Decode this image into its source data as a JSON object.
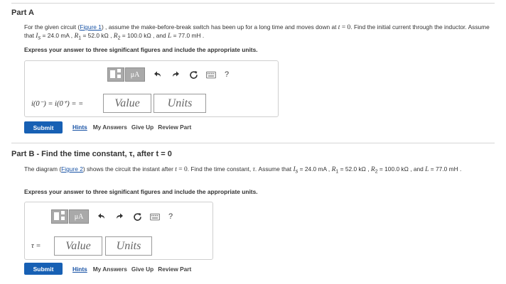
{
  "part_a": {
    "title": "Part A",
    "text_1": "For the given circuit (",
    "figure_link": "Figure 1",
    "text_2": ") , assume the make-before-break switch has been up for a long time and moves down at ",
    "math_t": "t",
    "math_eq0": " = 0",
    "text_3": ". Find the initial current through the inductor. Assume that ",
    "is_sym": "I",
    "is_sub": "s",
    "is_val": " = 24.0 mA",
    "r1_sym": "R",
    "r1_sub": "1",
    "r1_val": " = 52.0 kΩ",
    "r2_sym": "R",
    "r2_sub": "2",
    "r2_val": " = 100.0 kΩ",
    "l_sym": "L",
    "l_val": " = 77.0 mH",
    "sep": " , ",
    "and": " , and ",
    "end": " .",
    "instruction": "Express your answer to three significant figures and include the appropriate units.",
    "toolbar": {
      "mu_label": "μA",
      "help_label": "?"
    },
    "answer_lhs": "i(0⁻) = i(0⁺) = =",
    "value_placeholder": "Value",
    "units_placeholder": "Units",
    "submit_label": "Submit",
    "links": {
      "hints": "Hints",
      "my_answers": "My Answers",
      "give_up": "Give Up",
      "review_part": "Review Part"
    }
  },
  "part_b": {
    "title": "Part B - Find the time constant, τ, after t = 0",
    "text_1": "The diagram (",
    "figure_link": "Figure 2",
    "text_2": ") shows the circuit the instant after ",
    "math_t": "t",
    "math_eq0": " = 0",
    "text_3": ". Find the time constant, ",
    "tau": "τ",
    "text_4": ". Assume that ",
    "is_sym": "I",
    "is_sub": "s",
    "is_val": " = 24.0 mA",
    "r1_sym": "R",
    "r1_sub": "1",
    "r1_val": " = 52.0 kΩ",
    "r2_sym": "R",
    "r2_sub": "2",
    "r2_val": " = 100.0 kΩ",
    "l_sym": "L",
    "l_val": " = 77.0 mH",
    "sep": " , ",
    "and": " , and ",
    "end": " .",
    "instruction": "Express your answer to three significant figures and include the appropriate units.",
    "toolbar": {
      "mu_label": "μA",
      "help_label": "?"
    },
    "answer_lhs": "τ =",
    "value_placeholder": "Value",
    "units_placeholder": "Units",
    "submit_label": "Submit",
    "links": {
      "hints": "Hints",
      "my_answers": "My Answers",
      "give_up": "Give Up",
      "review_part": "Review Part"
    }
  },
  "colors": {
    "submit": "#1760b4",
    "link": "#1a54a6",
    "toolbar_button": "#a9a9a9"
  },
  "icons": [
    "template-icon",
    "mu-icon",
    "undo-icon",
    "redo-icon",
    "reset-icon",
    "keyboard-icon",
    "help-icon"
  ]
}
